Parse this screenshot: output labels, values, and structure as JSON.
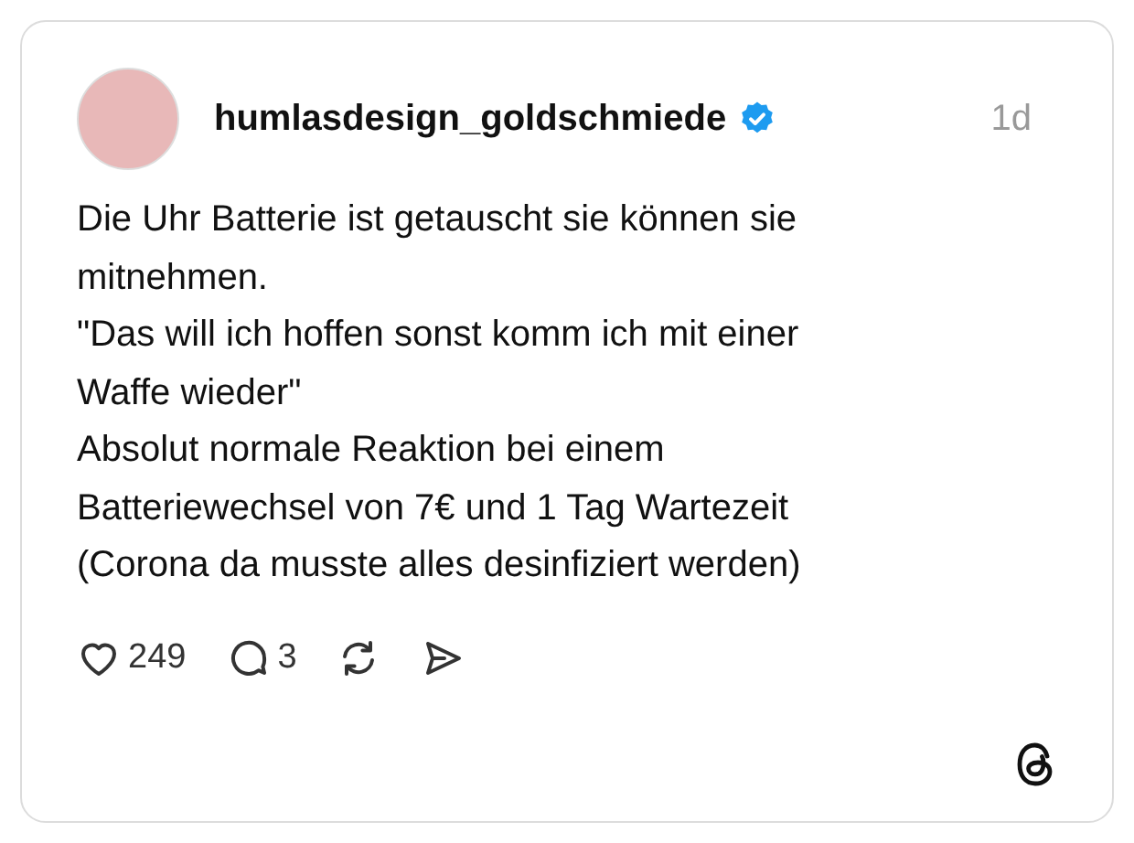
{
  "post": {
    "username": "humlasdesign_goldschmiede",
    "verified": true,
    "time": "1d",
    "text": "Die Uhr Batterie ist getauscht sie können sie mitnehmen.\n\"Das will ich hoffen sonst komm ich mit einer Waffe wieder\"\nAbsolut normale Reaktion bei einem Batteriewechsel von 7€ und 1 Tag Wartezeit\n(Corona da musste alles desinfiziert werden)",
    "actions": [
      {
        "kind": "like",
        "count": "249"
      },
      {
        "kind": "reply",
        "count": "3"
      },
      {
        "kind": "repost"
      },
      {
        "kind": "share"
      }
    ]
  }
}
